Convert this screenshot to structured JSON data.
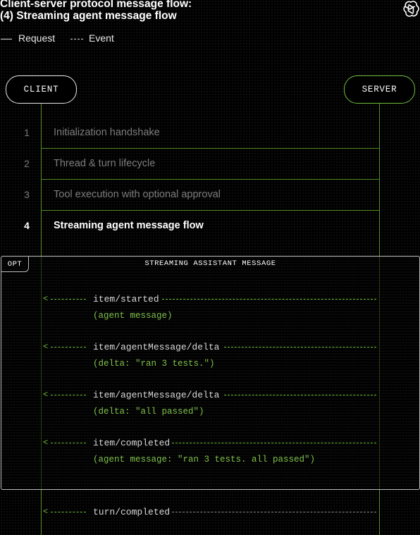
{
  "title": {
    "line1": "Client-server protocol message flow:",
    "line2": "(4) Streaming agent message flow"
  },
  "legend": {
    "request": "Request",
    "event": "Event"
  },
  "actors": {
    "client": "CLIENT",
    "server": "SERVER"
  },
  "steps": [
    {
      "num": "1",
      "label": "Initialization handshake"
    },
    {
      "num": "2",
      "label": "Thread & turn lifecycle"
    },
    {
      "num": "3",
      "label": "Tool execution with optional approval"
    },
    {
      "num": "4",
      "label": "Streaming agent message flow"
    }
  ],
  "opt": {
    "tag": "OPT",
    "title": "STREAMING ASSISTANT MESSAGE"
  },
  "messages": [
    {
      "label": "item/started",
      "payload": "(agent message)"
    },
    {
      "label": "item/agentMessage/delta",
      "payload": "(delta: \"ran 3 tests.\")"
    },
    {
      "label": "item/agentMessage/delta",
      "payload": "(delta: \"all passed\")"
    },
    {
      "label": "item/completed",
      "payload": "(agent message: \"ran 3 tests. all passed\")"
    }
  ],
  "final_message": {
    "label": "turn/completed"
  },
  "icons": {
    "logo": "openai-logo-icon"
  },
  "colors": {
    "background": "#000000",
    "accent_green": "#6fbf3a",
    "lifeline_green": "#5a8f2a",
    "payload_green": "#7dc04a"
  }
}
